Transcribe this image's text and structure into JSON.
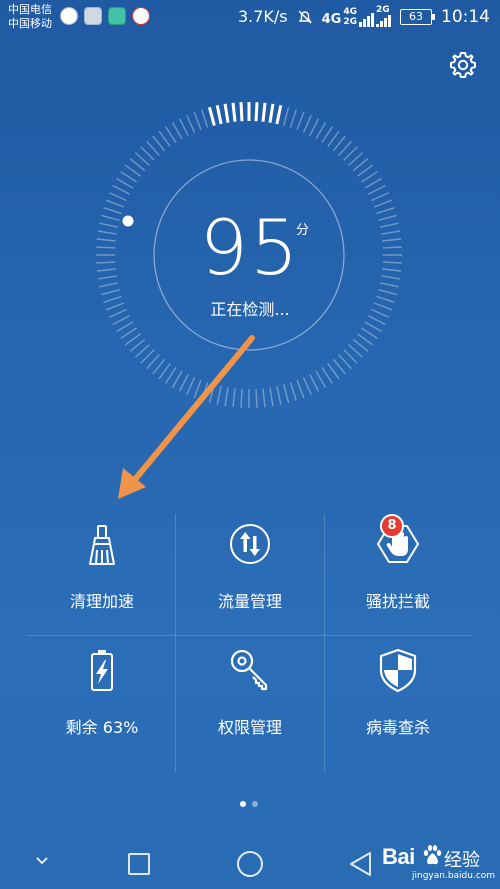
{
  "status_bar": {
    "carrier1": "中国电信",
    "carrier2": "中国移动",
    "net_speed": "3.7K/s",
    "network_4g": "4G",
    "network_4g_small": "4G",
    "network_2g_small": "2G",
    "network_2g": "2G",
    "battery": "63",
    "time": "10:14"
  },
  "header": {
    "settings_icon": "gear-icon"
  },
  "score": {
    "value": "95",
    "unit": "分",
    "status": "正在检测...",
    "progress_fraction": 0.05
  },
  "tools": [
    {
      "label": "清理加速",
      "icon": "broom-icon"
    },
    {
      "label": "流量管理",
      "icon": "data-transfer-icon"
    },
    {
      "label": "骚扰拦截",
      "icon": "block-hand-icon",
      "badge": "8"
    },
    {
      "label": "剩余 63%",
      "icon": "battery-charging-icon"
    },
    {
      "label": "权限管理",
      "icon": "key-icon"
    },
    {
      "label": "病毒查杀",
      "icon": "shield-icon"
    }
  ],
  "pager": {
    "pages": 2,
    "active": 0
  },
  "watermark": {
    "logo": "Bai",
    "cn": "经验",
    "url": "jingyan.baidu.com"
  },
  "colors": {
    "background": "#2766b0",
    "arrow": "#f0944a",
    "badge": "#e53a2f"
  }
}
